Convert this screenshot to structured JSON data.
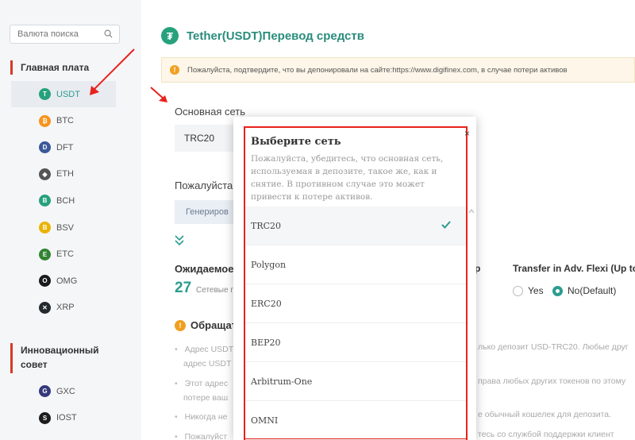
{
  "sidebar": {
    "search_placeholder": "Валюта поиска",
    "main_board_title": "Главная плата",
    "main_coins": [
      {
        "label": "USDT",
        "color": "#26a17b",
        "glyph": "T"
      },
      {
        "label": "BTC",
        "color": "#f7931a",
        "glyph": "₿"
      },
      {
        "label": "DFT",
        "color": "#3b5998",
        "glyph": "D"
      },
      {
        "label": "ETH",
        "color": "#555555",
        "glyph": "◆"
      },
      {
        "label": "BCH",
        "color": "#26a17b",
        "glyph": "B"
      },
      {
        "label": "BSV",
        "color": "#eab300",
        "glyph": "B"
      },
      {
        "label": "ETC",
        "color": "#328332",
        "glyph": "E"
      },
      {
        "label": "OMG",
        "color": "#1a1a1a",
        "glyph": "O"
      },
      {
        "label": "XRP",
        "color": "#23292f",
        "glyph": "✕"
      }
    ],
    "innovation_title_line1": "Инновационный",
    "innovation_title_line2": "совет",
    "innovation_coins": [
      {
        "label": "GXC",
        "color": "#35397a",
        "glyph": "G"
      },
      {
        "label": "IOST",
        "color": "#1c1c1c",
        "glyph": "S"
      }
    ]
  },
  "main": {
    "title": "Tether(USDT)Перевод средств",
    "notice": "Пожалуйста, подтвердите, что вы депонировали на сайте:https://www.digifinex.com, в случае потери активов",
    "network_label": "Основная сеть",
    "network_value": "TRC20",
    "please_text": "Пожалуйста,",
    "generate_button": "Генериров",
    "expected_title": "Ожидаемое",
    "expected_number": "27",
    "expected_sub": "Сетевые п",
    "attention_title": "Обращат",
    "bullets": [
      {
        "line1": "Адрес USDT",
        "line2": "адрес USDT"
      },
      {
        "line1": "Этот адрес",
        "line2": "потере ваш"
      },
      {
        "line1": "Никогда не",
        "line2": ""
      },
      {
        "line1": "Пожалуйст",
        "line2": ""
      }
    ],
    "right_fragments": [
      "лько депозит USD-TRC20. Любые друг",
      "права любых других токенов по этому",
      "е обычный кошелек для депозита.",
      "тесь со службой поддержки клиент"
    ],
    "frag_right_col": "р",
    "transfer_title": "Transfer in Adv. Flexi (Up to",
    "yes_label": "Yes",
    "no_label": "No(Default)"
  },
  "modal": {
    "title": "Выберите сеть",
    "description": "Пожалуйста, убедитесь, что основная сеть, используемая в депозите, такое же, как и снятие. В противном случае это может привести к потере активов.",
    "networks": [
      "TRC20",
      "Polygon",
      "ERC20",
      "BEP20",
      "Arbitrum-One",
      "OMNI"
    ],
    "selected": "TRC20",
    "close_glyph": "×"
  },
  "colors": {
    "accent": "#2a9d8f",
    "highlight_red": "#e8221c"
  }
}
